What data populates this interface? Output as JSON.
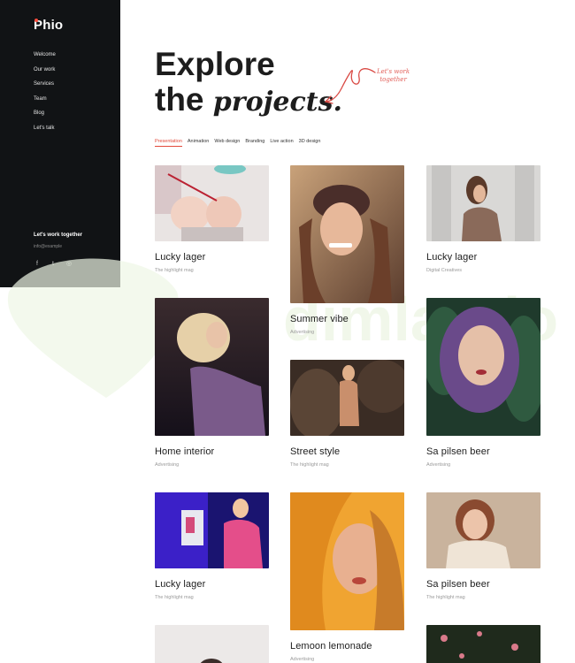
{
  "brand": {
    "name": "Phio",
    "accent": "#e24a3b"
  },
  "sidebar": {
    "items": [
      {
        "label": "Welcome"
      },
      {
        "label": "Our work"
      },
      {
        "label": "Services"
      },
      {
        "label": "Team"
      },
      {
        "label": "Blog"
      },
      {
        "label": "Let's talk"
      }
    ],
    "cta": "Let's work together",
    "email": "info@example",
    "social": [
      {
        "icon": "facebook-icon",
        "glyph": "f"
      },
      {
        "icon": "twitter-icon",
        "glyph": "t"
      },
      {
        "icon": "instagram-icon",
        "glyph": "◎"
      }
    ]
  },
  "hero": {
    "line1": "Explore",
    "line2_plain": "the",
    "line2_italic": "projects.",
    "note_line1": "Let's work",
    "note_line2": "together"
  },
  "tabs": [
    {
      "label": "Presentation",
      "active": true
    },
    {
      "label": "Animation",
      "active": false
    },
    {
      "label": "Web design",
      "active": false
    },
    {
      "label": "Branding",
      "active": false
    },
    {
      "label": "Live action",
      "active": false
    },
    {
      "label": "3D design",
      "active": false
    }
  ],
  "projects": [
    {
      "title": "Lucky lager",
      "subtitle": "The highlight mag"
    },
    {
      "title": "Summer vibe",
      "subtitle": "Advertising"
    },
    {
      "title": "Lucky lager",
      "subtitle": "Digital Creatives"
    },
    {
      "title": "Home interior",
      "subtitle": "Advertising"
    },
    {
      "title": "Street style",
      "subtitle": "The highlight mag"
    },
    {
      "title": "Sa pilsen beer",
      "subtitle": "Advertising"
    },
    {
      "title": "Lucky lager",
      "subtitle": "The highlight mag"
    },
    {
      "title": "Lemoon lemonade",
      "subtitle": "Advertising"
    },
    {
      "title": "Sa pilsen beer",
      "subtitle": "The highlight mag"
    }
  ],
  "watermark_text": "dimlaptio"
}
